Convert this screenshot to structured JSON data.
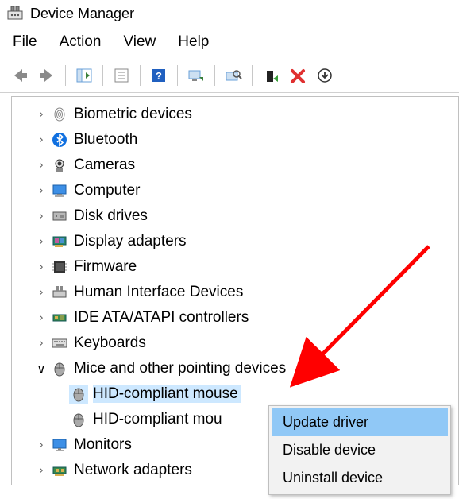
{
  "window": {
    "title": "Device Manager"
  },
  "menu": {
    "file": "File",
    "action": "Action",
    "view": "View",
    "help": "Help"
  },
  "toolbar": {
    "back": "back",
    "forward": "forward",
    "show_hide": "show-hide",
    "properties": "properties",
    "help": "help",
    "scan": "scan",
    "find": "find",
    "update": "update-driver",
    "remove": "remove",
    "uninstall": "uninstall"
  },
  "tree": {
    "items": [
      {
        "label": "Biometric devices",
        "icon": "fingerprint",
        "expanded": false
      },
      {
        "label": "Bluetooth",
        "icon": "bluetooth",
        "expanded": false
      },
      {
        "label": "Cameras",
        "icon": "camera",
        "expanded": false
      },
      {
        "label": "Computer",
        "icon": "computer",
        "expanded": false
      },
      {
        "label": "Disk drives",
        "icon": "disk",
        "expanded": false
      },
      {
        "label": "Display adapters",
        "icon": "display-adapter",
        "expanded": false
      },
      {
        "label": "Firmware",
        "icon": "firmware",
        "expanded": false
      },
      {
        "label": "Human Interface Devices",
        "icon": "hid",
        "expanded": false
      },
      {
        "label": "IDE ATA/ATAPI controllers",
        "icon": "ide",
        "expanded": false
      },
      {
        "label": "Keyboards",
        "icon": "keyboard",
        "expanded": false
      },
      {
        "label": "Mice and other pointing devices",
        "icon": "mouse",
        "expanded": true,
        "children": [
          {
            "label": "HID-compliant mouse",
            "icon": "mouse",
            "selected": true
          },
          {
            "label": "HID-compliant mou",
            "icon": "mouse",
            "selected": false
          }
        ]
      },
      {
        "label": "Monitors",
        "icon": "monitor",
        "expanded": false
      },
      {
        "label": "Network adapters",
        "icon": "network",
        "expanded": false
      }
    ]
  },
  "context_menu": {
    "items": [
      {
        "label": "Update driver",
        "hover": true
      },
      {
        "label": "Disable device",
        "hover": false
      },
      {
        "label": "Uninstall device",
        "hover": false
      }
    ]
  }
}
